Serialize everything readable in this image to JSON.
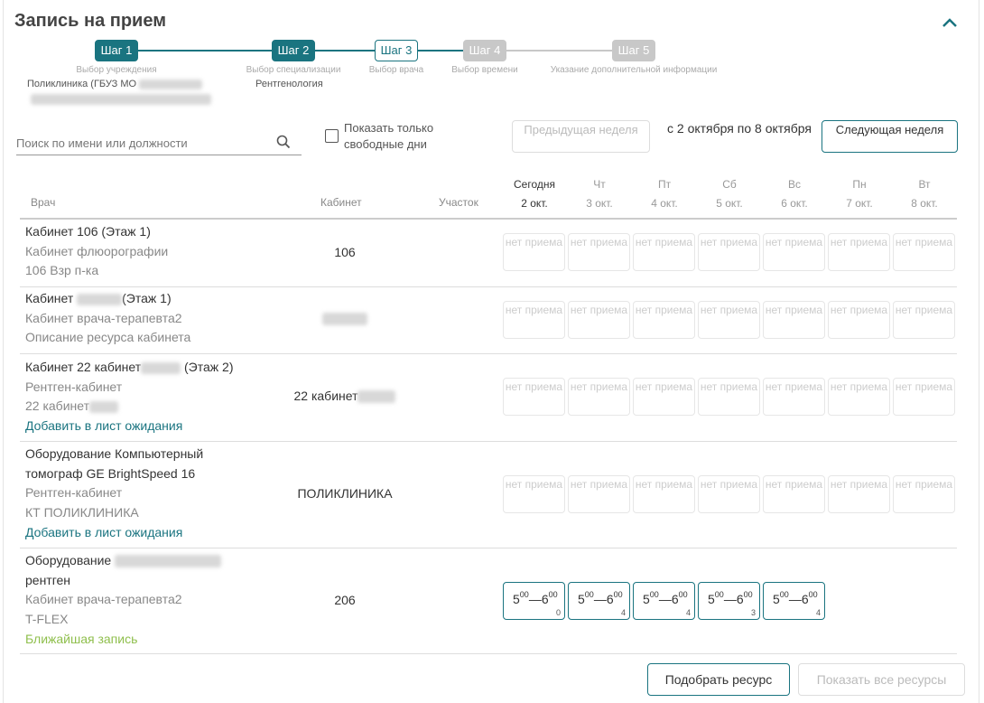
{
  "header": {
    "title": "Запись на прием"
  },
  "steps": [
    {
      "label": "Шаг 1",
      "caption": "Выбор учреждения",
      "value": "Поликлиника (ГБУЗ МО"
    },
    {
      "label": "Шаг 2",
      "caption": "Выбор специализации",
      "value": "Рентгенология"
    },
    {
      "label": "Шаг 3",
      "caption": "Выбор врача",
      "value": ""
    },
    {
      "label": "Шаг 4",
      "caption": "Выбор времени",
      "value": ""
    },
    {
      "label": "Шаг 5",
      "caption": "Указание дополнительной информации",
      "value": ""
    }
  ],
  "filters": {
    "search_placeholder": "Поиск по имени или должности",
    "free_days_label": "Показать только свободные дни",
    "free_days_checked": false,
    "prev_week": "Предыдущая неделя",
    "next_week": "Следующая неделя",
    "date_range": "с 2 октября по 8 октября"
  },
  "table": {
    "col_doctor": "Врач",
    "col_cabinet": "Кабинет",
    "col_area": "Участок",
    "days": [
      {
        "dow": "Сегодня",
        "date": "2 окт."
      },
      {
        "dow": "Чт",
        "date": "3 окт."
      },
      {
        "dow": "Пт",
        "date": "4 окт."
      },
      {
        "dow": "Сб",
        "date": "5 окт."
      },
      {
        "dow": "Вс",
        "date": "6 окт."
      },
      {
        "dow": "Пн",
        "date": "7 окт."
      },
      {
        "dow": "Вт",
        "date": "8 окт."
      }
    ],
    "no_reception": "нет приема",
    "rows": [
      {
        "line1": "Кабинет 106 (Этаж 1)",
        "line2": "Кабинет флюорографии",
        "line3": "106 Взр п-ка",
        "cabinet": "106"
      },
      {
        "line1a": "Кабинет",
        "line1b": "(Этаж 1)",
        "line2": "Кабинет врача-терапевта2",
        "line3": "Описание ресурса кабинета",
        "cabinet": ""
      },
      {
        "line1a": "Кабинет 22 кабинет",
        "line1b": "(Этаж 2)",
        "line2": "Рентген-кабинет",
        "line3": "22 кабинет",
        "link": "Добавить в лист ожидания",
        "cabinet": "22 кабинет"
      },
      {
        "line1": "Оборудование Компьютерный",
        "line1c": "томограф GE BrightSpeed 16",
        "line2": "Рентген-кабинет",
        "line3": "КТ ПОЛИКЛИНИКА",
        "link": "Добавить в лист ожидания",
        "cabinet": "ПОЛИКЛИНИКА"
      },
      {
        "line1": "Оборудование",
        "line1c": "рентген",
        "line2": "Кабинет врача-терапевта2",
        "line3": "T-FLEX",
        "nearest": "Ближайшая запись",
        "cabinet": "206",
        "slots": [
          {
            "from_h": "5",
            "from_m": "00",
            "to_h": "6",
            "to_m": "00",
            "count": "0"
          },
          {
            "from_h": "5",
            "from_m": "00",
            "to_h": "6",
            "to_m": "00",
            "count": "4"
          },
          {
            "from_h": "5",
            "from_m": "00",
            "to_h": "6",
            "to_m": "00",
            "count": "4"
          },
          {
            "from_h": "5",
            "from_m": "00",
            "to_h": "6",
            "to_m": "00",
            "count": "3"
          },
          {
            "from_h": "5",
            "from_m": "00",
            "to_h": "6",
            "to_m": "00",
            "count": "4"
          }
        ]
      }
    ]
  },
  "footer": {
    "pick_resource": "Подобрать ресурс",
    "show_all": "Показать все ресурсы"
  },
  "colors": {
    "accent": "#1a7480",
    "disabled": "#c8c8c8",
    "nearest": "#8fbf4d"
  }
}
